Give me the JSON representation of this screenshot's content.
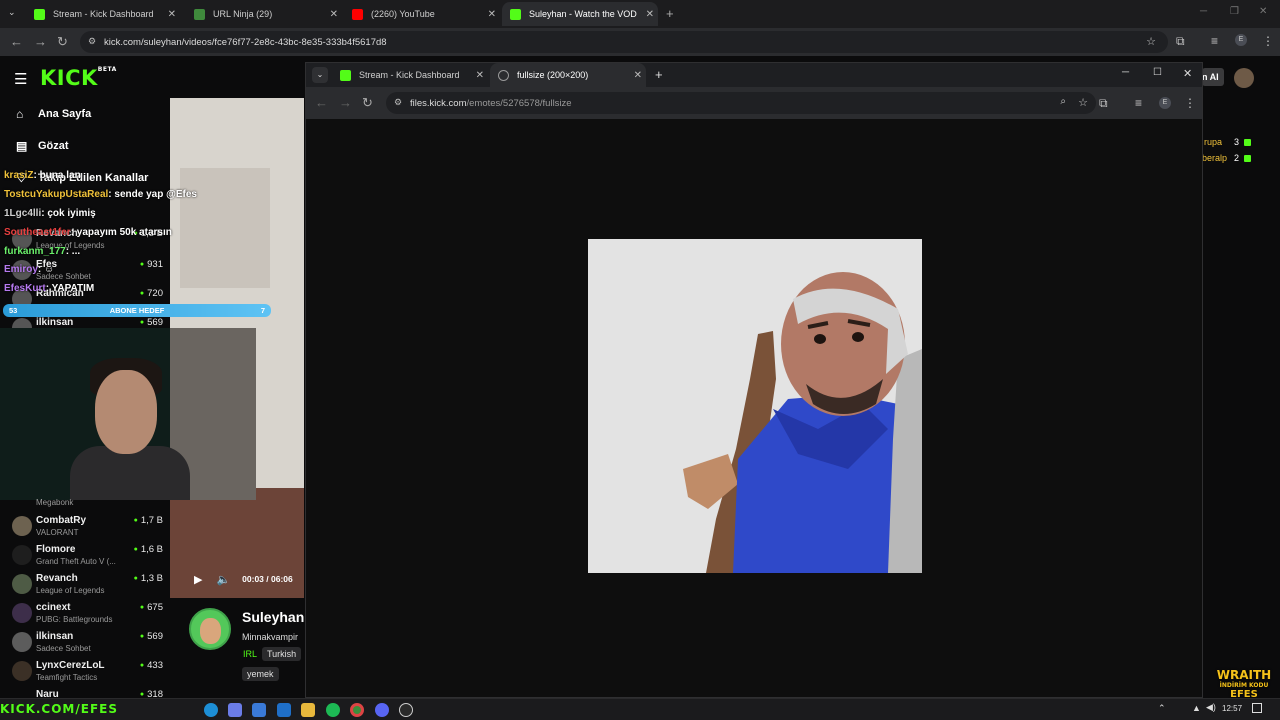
{
  "browser": {
    "tabs": [
      {
        "label": "Stream - Kick Dashboard",
        "color": "#53fc18"
      },
      {
        "label": "URL Ninja (29)",
        "color": "#3f8a3c"
      },
      {
        "label": "(2260) YouTube",
        "color": "#ff0000"
      },
      {
        "label": "Suleyhan - Watch the VOD on Kick",
        "color": "#53fc18"
      }
    ],
    "new_tab": "+",
    "url": "kick.com/suleyhan/videos/fce76f77-2e8c-43bc-8e35-333b4f5617d8"
  },
  "kick": {
    "logo": "KICK",
    "logo_badge": "BETA",
    "nav": [
      {
        "label": "Ana Sayfa",
        "icon": "home-icon"
      },
      {
        "label": "Gözat",
        "icon": "browse-icon"
      },
      {
        "label": "Takip Edilen Kanallar",
        "icon": "follow-icon"
      }
    ],
    "channels_top": [
      {
        "name": "Revanch",
        "category": "League of Legends",
        "viewers": "1,3 B"
      },
      {
        "name": "Efes",
        "category": "Sadece Sohbet",
        "viewers": "931"
      },
      {
        "name": "Rahmican",
        "category": "",
        "viewers": "720"
      },
      {
        "name": "ilkinsan",
        "category": "",
        "viewers": "569"
      }
    ],
    "channels_bottom": [
      {
        "name": "",
        "category": "Megabonk",
        "viewers": ""
      },
      {
        "name": "CombatRy",
        "category": "VALORANT",
        "viewers": "1,7 B"
      },
      {
        "name": "Flomore",
        "category": "Grand Theft Auto V (...",
        "viewers": "1,6 B"
      },
      {
        "name": "Revanch",
        "category": "League of Legends",
        "viewers": "1,3 B"
      },
      {
        "name": "ccinext",
        "category": "PUBG: Battlegrounds",
        "viewers": "675"
      },
      {
        "name": "ilkinsan",
        "category": "Sadece Sohbet",
        "viewers": "569"
      },
      {
        "name": "LynxCerezLoL",
        "category": "Teamfight Tactics",
        "viewers": "433"
      },
      {
        "name": "Naru",
        "category": "",
        "viewers": "318"
      }
    ],
    "overlay_chat": [
      {
        "user": "krasiZ",
        "text": ": buna lan",
        "color": "#f0c23a"
      },
      {
        "user": "TostcuYakupUstaReal",
        "text": ": sende yap @Efes",
        "color": "#f0c23a"
      },
      {
        "user": "1Lgc4lli",
        "text": ": çok iyimiş",
        "color": "#d0d0d0"
      },
      {
        "user": "Southeast1fer",
        "text": ": yapayım 50k atarsın",
        "color": "#e84040"
      },
      {
        "user": "furkanm_177",
        "text": ": ...",
        "color": "#6bf06b"
      },
      {
        "user": "Emiroy",
        "text": ": ☺",
        "color": "#b77af0"
      },
      {
        "user": "EfesKurt",
        "text": ": YAPATIM",
        "color": "#b77af0"
      }
    ],
    "sub_goal": {
      "left": "53",
      "label": "ABONE HEDEF",
      "right": "7"
    },
    "player": {
      "time": "00:03 / 06:06"
    },
    "streamer": {
      "name": "Suleyhan",
      "title": "Minnakvampir",
      "tags": [
        "IRL",
        "Turkish",
        "yemek"
      ]
    },
    "right_side": [
      {
        "name": "rupa",
        "count": "3"
      },
      {
        "name": "beralp",
        "count": "2"
      }
    ],
    "right_button": "n AI"
  },
  "popup": {
    "tabs": [
      {
        "label": "Stream - Kick Dashboard"
      },
      {
        "label": "fullsize (200×200)"
      }
    ],
    "url_host": "files.kick.com",
    "url_path": "/emotes/5276578/fullsize"
  },
  "taskbar": {
    "streamer_link": "KICK.COM/EFES",
    "time": "12:57",
    "sponsor_line1": "WRAITH",
    "sponsor_line2": "İNDİRİM KODU",
    "sponsor_line3": "EFES"
  }
}
